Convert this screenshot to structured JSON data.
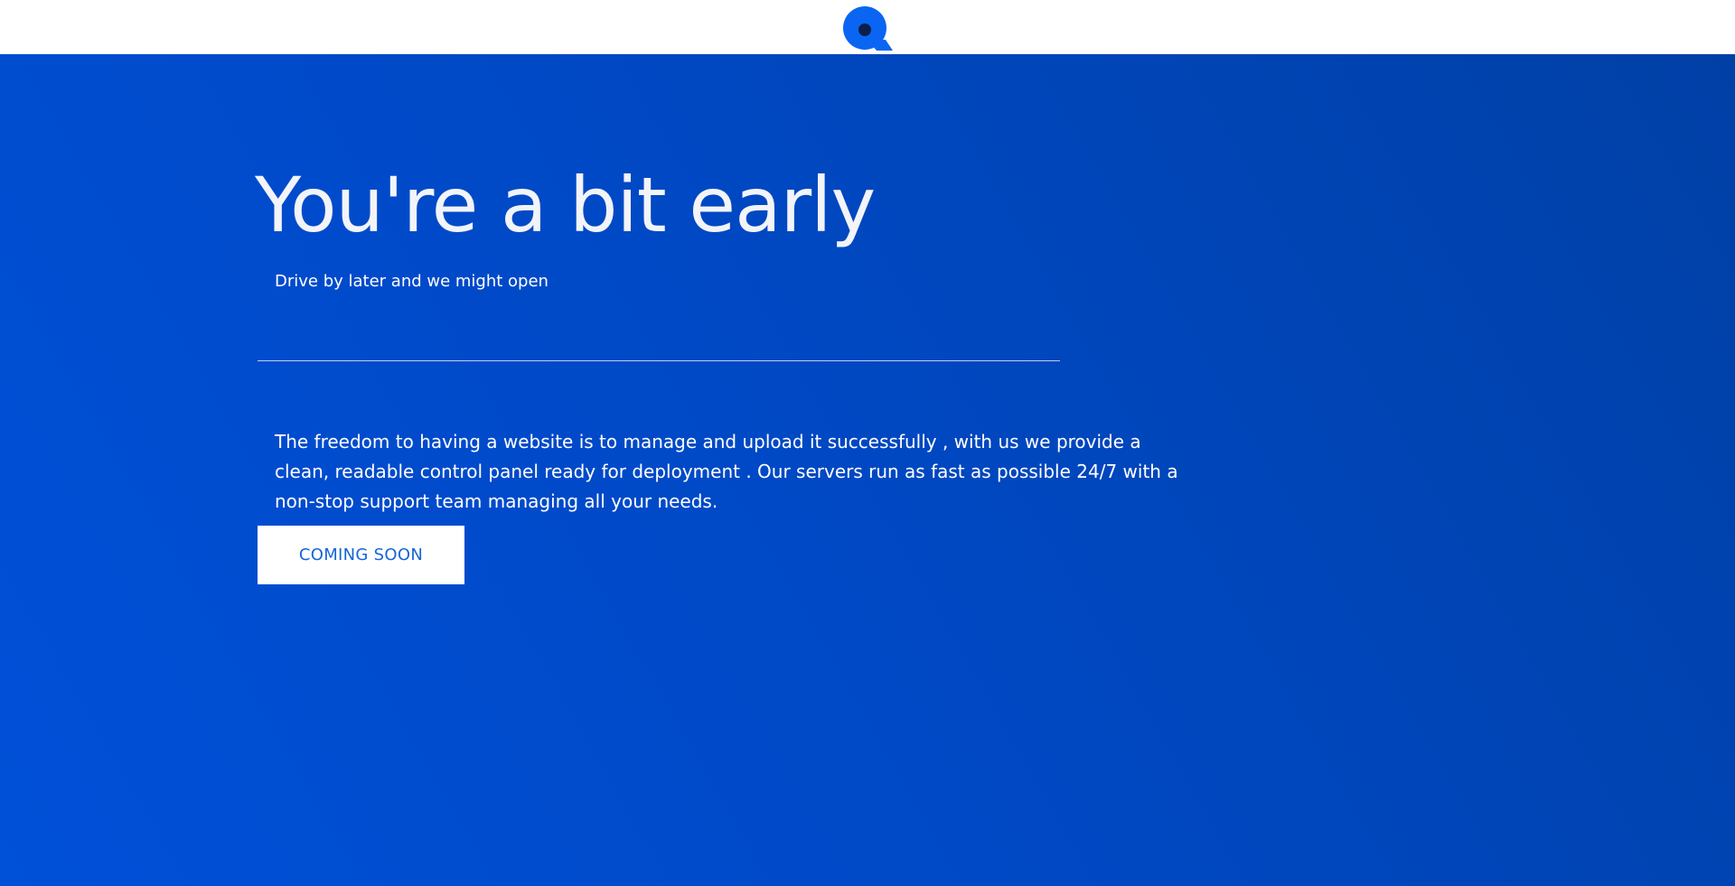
{
  "header": {
    "logo_icon": "q-logo-icon",
    "logo_color": "#0a66f2"
  },
  "hero": {
    "title": "You're a bit early",
    "subtitle": "Drive by later and we might open",
    "description": "The freedom to having a website is to manage and upload it successfully , with us we provide a clean, readable control panel ready for deployment . Our servers run as fast as possible 24/7 with a non-stop support team managing all your needs.",
    "button_label": "COMING SOON",
    "background_color": "#0049c6",
    "button_text_color": "#1565d8"
  }
}
